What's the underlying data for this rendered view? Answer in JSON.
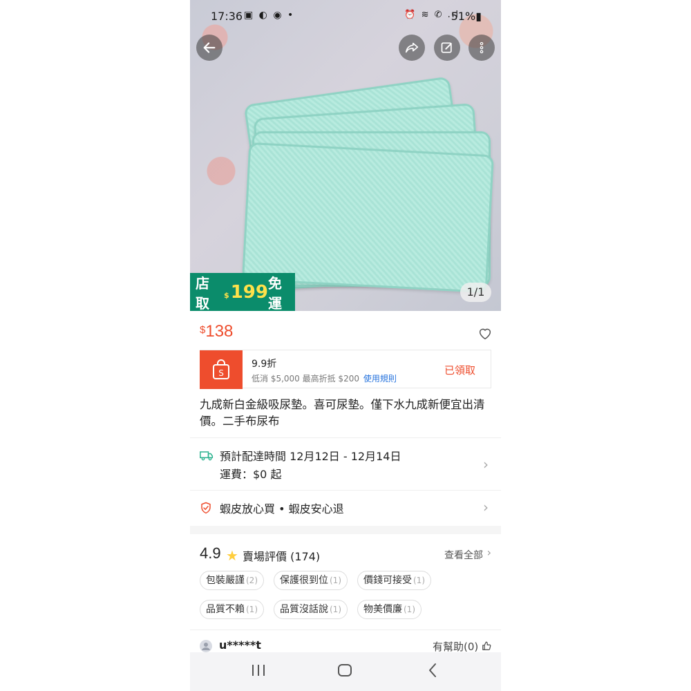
{
  "status_bar": {
    "time": "17:36",
    "left_icons": "▣ ◐ ◉ •",
    "right_icons": "⏰ ≋ ✆ .ıl",
    "battery": "51%▮"
  },
  "hero": {
    "promo_prefix": "店取",
    "promo_dollar": "$",
    "promo_number": "199",
    "promo_suffix": "免運",
    "pager": "1/1"
  },
  "price": {
    "currency": "$",
    "value": "138"
  },
  "voucher": {
    "title": "9.9折",
    "desc": "低消 $5,000 最高折抵 $200",
    "rules_link": "使用規則",
    "status": "已領取"
  },
  "product_title": "九成新白金級吸尿墊。喜可尿墊。僅下水九成新便宜出清價。二手布尿布",
  "shipping": {
    "line1": "預計配達時間 12月12日 - 12月14日",
    "line2": "運費：$0 起"
  },
  "guarantee": {
    "text": "蝦皮放心買 • 蝦皮安心退"
  },
  "rating": {
    "score": "4.9",
    "label": "賣場評價 (174)",
    "view_all": "查看全部"
  },
  "tags": [
    {
      "label": "包裝嚴謹",
      "count": "(2)"
    },
    {
      "label": "保護很到位",
      "count": "(1)"
    },
    {
      "label": "價錢可接受",
      "count": "(1)"
    },
    {
      "label": "品質不賴",
      "count": "(1)"
    },
    {
      "label": "品質沒話說",
      "count": "(1)"
    },
    {
      "label": "物美價廉",
      "count": "(1)"
    }
  ],
  "review": {
    "reviewer": "u*****t",
    "helpful": "有幫助(0)"
  },
  "colors": {
    "brand": "#ee4d2d",
    "promo_green": "#0b8c6b",
    "link": "#2673dd"
  }
}
